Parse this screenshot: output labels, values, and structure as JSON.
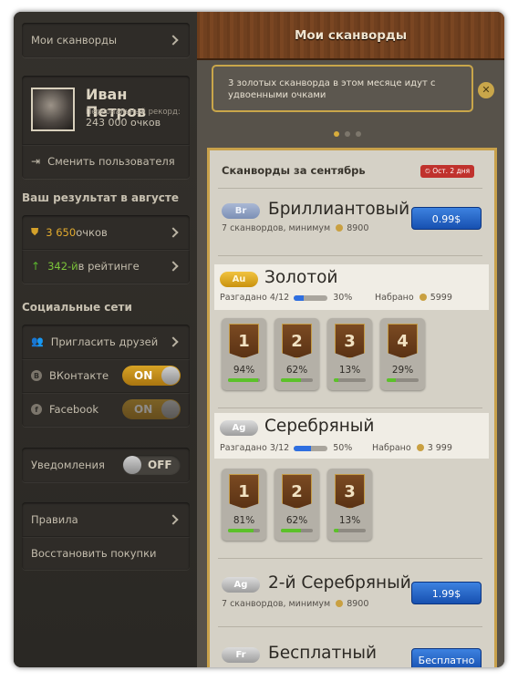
{
  "sidebar": {
    "my_scanwords": "Мои сканворды",
    "user": {
      "name": "Иван Петров",
      "record_label": "Персональный рекорд:",
      "points": "243 000 очков"
    },
    "switch_user": "Сменить пользователя",
    "result_title": "Ваш результат в августе",
    "points_value": "3 650",
    "points_unit": " очков",
    "rating_value": "342-й",
    "rating_unit": " в рейтинге",
    "social_title": "Социальные сети",
    "invite": "Пригласить друзей",
    "vk_label": "ВКонтакте",
    "vk_toggle": "ON",
    "fb_label": "Facebook",
    "fb_toggle": "ON",
    "notifications": "Уведомления",
    "notifications_toggle": "OFF",
    "rules": "Правила",
    "restore": "Восстановить покупки"
  },
  "main": {
    "header_title": "Мои сканворды",
    "notice": "3 золотых сканворда в этом месяце идут с удвоенными очками",
    "panel_title": "Сканворды за сентябрь",
    "deadline": "Ост. 2 дня",
    "levels": [
      {
        "badge": "Br",
        "title": "Бриллиантовый",
        "sub": "7 сканвордов, минимум",
        "min": "8900",
        "price": "0.99$"
      },
      {
        "badge": "Au",
        "title": "Золотой",
        "solved_label": "Разгадано 4/12",
        "solved_pct": "30%",
        "solved_frac": 0.3,
        "score_label": "Набрано",
        "score": "5999",
        "cards": [
          {
            "n": "1",
            "pct": "94%",
            "frac": 0.94
          },
          {
            "n": "2",
            "pct": "62%",
            "frac": 0.62
          },
          {
            "n": "3",
            "pct": "13%",
            "frac": 0.13
          },
          {
            "n": "4",
            "pct": "29%",
            "frac": 0.29
          }
        ]
      },
      {
        "badge": "Ag",
        "title": "Серебряный",
        "solved_label": "Разгадано 3/12",
        "solved_pct": "50%",
        "solved_frac": 0.5,
        "score_label": "Набрано",
        "score": "3 999",
        "cards": [
          {
            "n": "1",
            "pct": "81%",
            "frac": 0.81
          },
          {
            "n": "2",
            "pct": "62%",
            "frac": 0.62
          },
          {
            "n": "3",
            "pct": "13%",
            "frac": 0.13
          }
        ]
      },
      {
        "badge": "Ag",
        "title": "2-й Серебряный",
        "sub": "7 сканвордов, минимум",
        "min": "8900",
        "price": "1.99$"
      },
      {
        "badge": "Fr",
        "title": "Бесплатный",
        "price": "Бесплатно"
      }
    ]
  },
  "colors": {
    "accent_gold": "#c9a64a",
    "blue_button": "#2f6fe0",
    "progress_green": "#5cc12a"
  }
}
